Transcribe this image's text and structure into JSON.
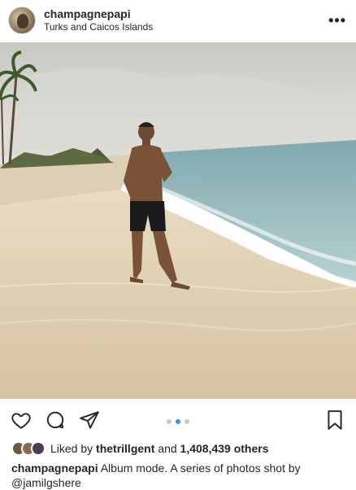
{
  "post": {
    "username": "champagnepapi",
    "location": "Turks and Caicos Islands",
    "more_label": "•••"
  },
  "carousel": {
    "count": 3,
    "active_index": 1
  },
  "likes": {
    "prefix": "Liked by",
    "liker": "thetrillgent",
    "joiner": "and",
    "others": "1,408,439 others"
  },
  "caption": {
    "username": "champagnepapi",
    "text": "Album mode. A series of photos shot by",
    "mention": "@jamilgshere"
  },
  "icons": {
    "more": "more-options-icon",
    "like": "heart-icon",
    "comment": "comment-bubble-icon",
    "share": "paper-plane-icon",
    "save": "bookmark-icon"
  },
  "colors": {
    "text": "#262626",
    "carousel_active": "#3897f0",
    "carousel_inactive": "#c7c7c7"
  }
}
